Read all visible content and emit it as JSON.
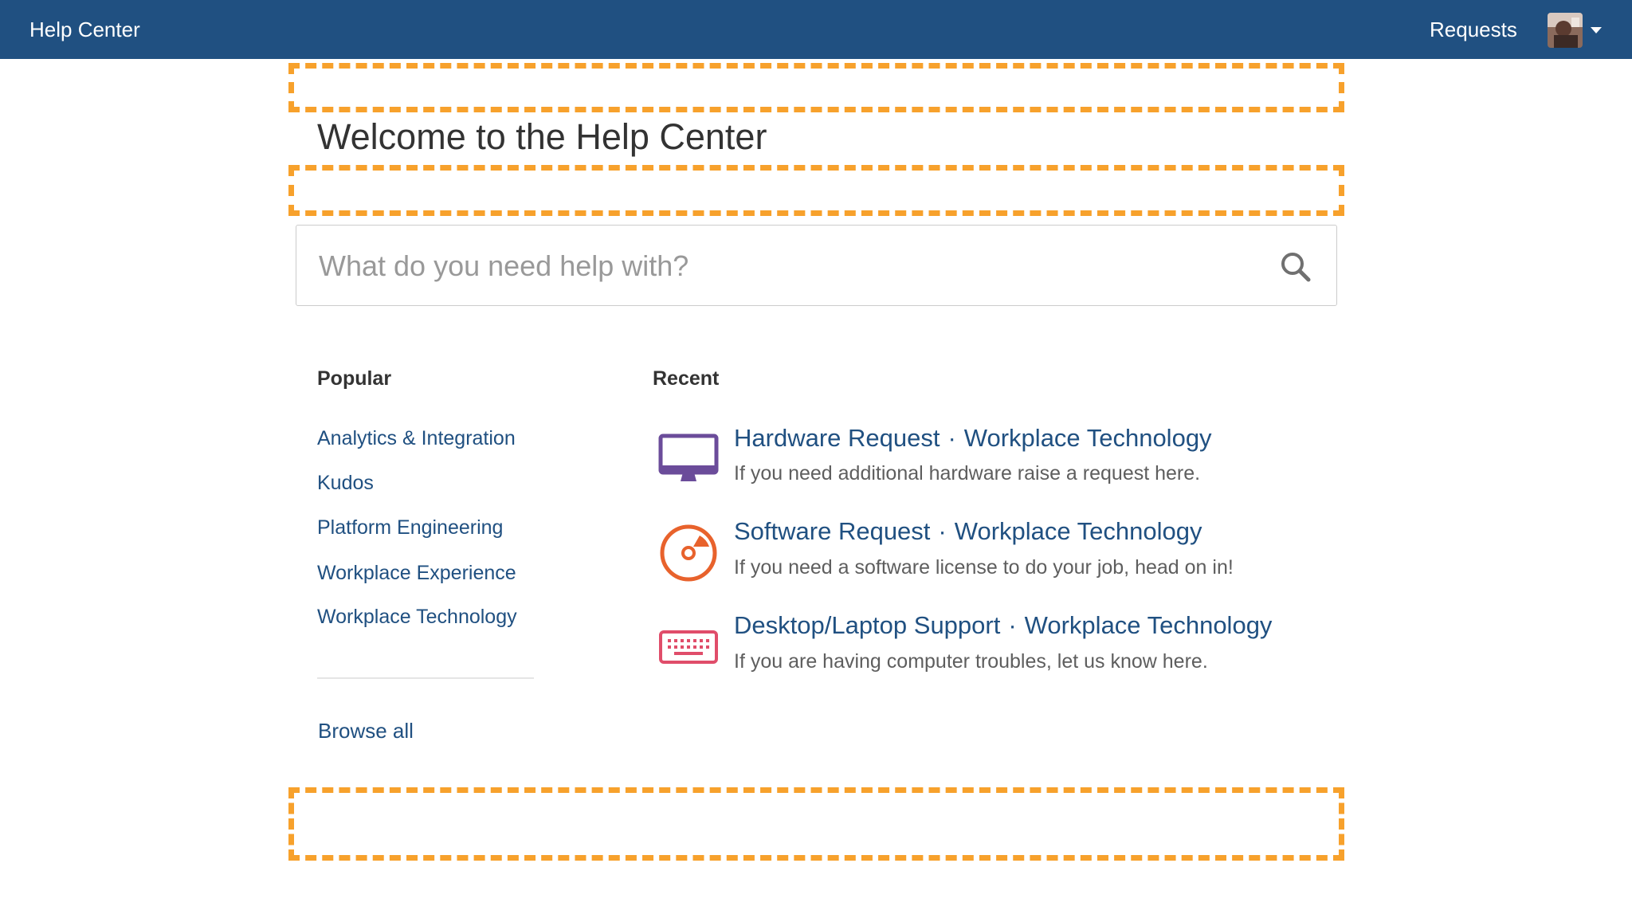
{
  "header": {
    "brand": "Help Center",
    "requests_label": "Requests"
  },
  "main": {
    "title": "Welcome to the Help Center",
    "search": {
      "placeholder": "What do you need help with?",
      "value": ""
    }
  },
  "popular": {
    "heading": "Popular",
    "items": [
      {
        "label": "Analytics & Integration"
      },
      {
        "label": "Kudos"
      },
      {
        "label": "Platform Engineering"
      },
      {
        "label": "Workplace Experience"
      },
      {
        "label": "Workplace Technology"
      }
    ],
    "browse_all": "Browse all"
  },
  "recent": {
    "heading": "Recent",
    "separator": "·",
    "items": [
      {
        "icon": "monitor-icon",
        "color": "#6b4c9a",
        "title": "Hardware Request",
        "project": "Workplace Technology",
        "description": "If you need additional hardware raise a request here."
      },
      {
        "icon": "disc-icon",
        "color": "#e8622c",
        "title": "Software Request",
        "project": "Workplace Technology",
        "description": "If you need a software license to do your job, head on in!"
      },
      {
        "icon": "keyboard-icon",
        "color": "#e04d6a",
        "title": "Desktop/Laptop Support",
        "project": "Workplace Technology",
        "description": "If you are having computer troubles, let us know here."
      }
    ]
  },
  "colors": {
    "header_bg": "#205081",
    "link": "#205081",
    "highlight_dash": "#f7a12c"
  }
}
